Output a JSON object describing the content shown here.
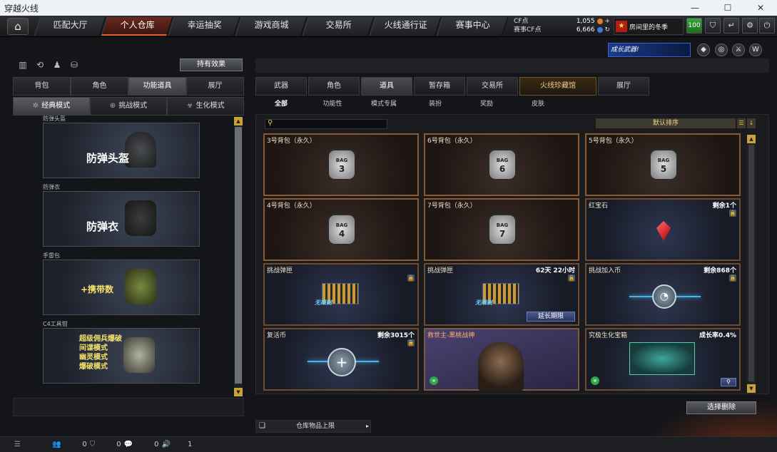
{
  "window": {
    "title": "穿越火线",
    "minimize_icon": "minimize-icon",
    "maximize_icon": "maximize-icon",
    "close_icon": "close-icon"
  },
  "nav": {
    "tabs": [
      "匹配大厅",
      "个人仓库",
      "幸运抽奖",
      "游戏商城",
      "交易所",
      "火线通行证",
      "赛事中心"
    ],
    "active_tab": "个人仓库",
    "cf_label": "CF点",
    "cf_value": "1,055",
    "event_cf_label": "赛事CF点",
    "event_cf_value": "6,666",
    "username": "房间里的冬季",
    "level": "100"
  },
  "left": {
    "effect_button": "持有效果",
    "tabs": [
      "背包",
      "角色",
      "功能道具",
      "展厅"
    ],
    "active_tab": "功能道具",
    "modes": [
      "经典模式",
      "挑战模式",
      "生化模式"
    ],
    "active_mode": "经典模式",
    "items": [
      {
        "caption": "防弹头盔",
        "label": "防弹头盔"
      },
      {
        "caption": "防弹衣",
        "label": "防弹衣"
      },
      {
        "caption": "手雷包",
        "label": "+携带数"
      },
      {
        "caption": "C4工具钳",
        "label": "超级佣兵爆破\n间谍模式\n幽灵模式\n爆破模式"
      }
    ]
  },
  "right": {
    "banner": "成长武器!",
    "tabs": [
      "武器",
      "角色",
      "道具",
      "暂存箱",
      "交易所",
      "火线珍藏馆",
      "展厅"
    ],
    "active_tab": "道具",
    "subtabs": [
      "全部",
      "功能性",
      "模式专属",
      "装扮",
      "奖励",
      "皮肤"
    ],
    "active_subtab": "全部",
    "sort_label": "默认排序",
    "items": [
      {
        "name": "3号背包（永久）",
        "num": "3"
      },
      {
        "name": "6号背包（永久）",
        "num": "6"
      },
      {
        "name": "5号背包（永久）",
        "num": "5"
      },
      {
        "name": "4号背包（永久）",
        "num": "4"
      },
      {
        "name": "7号背包（永久）",
        "num": "7"
      },
      {
        "name": "红宝石",
        "info": "剩余1个"
      },
      {
        "name": "挑战弹匣",
        "tag": "无限制"
      },
      {
        "name": "挑战弹匣",
        "info": "62天 22小时",
        "tag": "无限制",
        "button": "延长期限"
      },
      {
        "name": "挑战加入币",
        "info": "剩余868个"
      },
      {
        "name": "复活币",
        "info": "剩余3015个"
      },
      {
        "name": "救世主-黑桃战神"
      },
      {
        "name": "究极生化宝箱",
        "info": "成长率0.4%"
      }
    ],
    "select_delete": "选择删除",
    "storage_limit": "仓库物品上限"
  },
  "status": {
    "count1": "0",
    "count2": "0",
    "count3": "0",
    "count4": "1"
  }
}
